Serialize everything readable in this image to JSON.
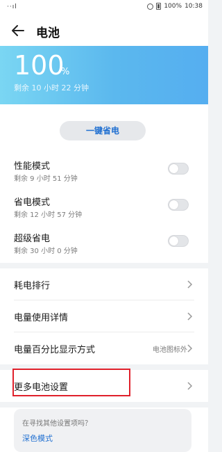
{
  "status_bar": {
    "signal": "··ıl",
    "battery_text": "100%",
    "time": "10:38"
  },
  "app_bar": {
    "title": "电池",
    "back_icon": "arrow-left-icon"
  },
  "battery": {
    "percent": "100",
    "unit": "%",
    "remaining": "剩余 10 小时 22 分钟",
    "gradient_colors": [
      "#7ad6f3",
      "#55aef0"
    ]
  },
  "power_saver_button": "一键省电",
  "modes": [
    {
      "title": "性能模式",
      "subtitle": "剩余 9 小时 51 分钟",
      "enabled": false
    },
    {
      "title": "省电模式",
      "subtitle": "剩余 12 小时 57 分钟",
      "enabled": false
    },
    {
      "title": "超级省电",
      "subtitle": "剩余 30 小时 0 分钟",
      "enabled": false
    }
  ],
  "list_items": [
    {
      "label": "耗电排行",
      "value": ""
    },
    {
      "label": "电量使用详情",
      "value": ""
    },
    {
      "label": "电量百分比显示方式",
      "value": "电池图标外"
    },
    {
      "label": "更多电池设置",
      "value": ""
    }
  ],
  "suggestion": {
    "question": "在寻找其他设置项吗？",
    "link": "深色模式"
  },
  "colors": {
    "accent": "#1f6fd1",
    "highlight_box": "#e0202b"
  }
}
